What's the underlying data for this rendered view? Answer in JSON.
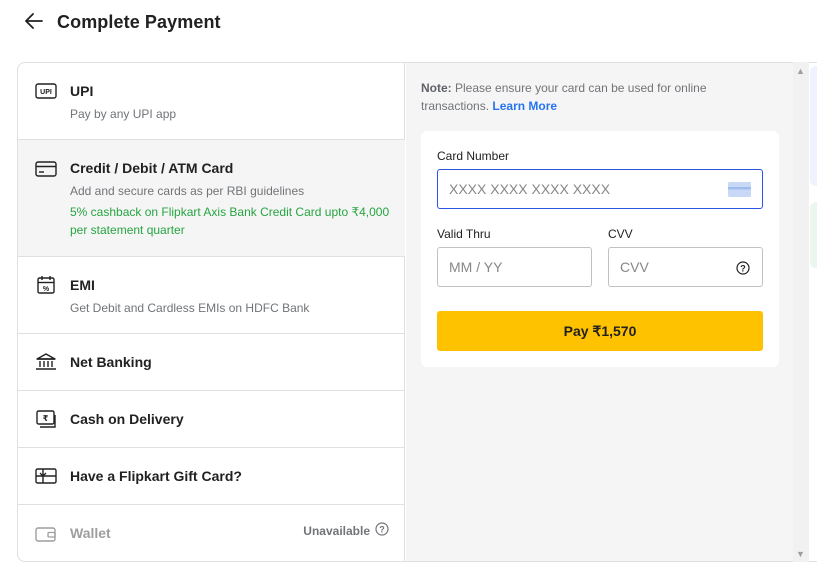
{
  "header": {
    "title": "Complete Payment",
    "back_icon": "arrow-left-icon"
  },
  "payment_options": [
    {
      "id": "upi",
      "icon": "upi-icon",
      "title": "UPI",
      "subtitle": "Pay by any UPI app"
    },
    {
      "id": "card",
      "icon": "card-icon",
      "title": "Credit / Debit / ATM Card",
      "subtitle": "Add and secure cards as per RBI guidelines",
      "offer": "5% cashback on Flipkart Axis Bank Credit Card upto ₹4,000 per statement quarter",
      "selected": true
    },
    {
      "id": "emi",
      "icon": "emi-calendar-icon",
      "title": "EMI",
      "subtitle": "Get Debit and Cardless EMIs on HDFC Bank"
    },
    {
      "id": "netbanking",
      "icon": "bank-icon",
      "title": "Net Banking"
    },
    {
      "id": "cod",
      "icon": "cash-icon",
      "title": "Cash on Delivery"
    },
    {
      "id": "giftcard",
      "icon": "gift-card-icon",
      "title": "Have a Flipkart Gift Card?"
    },
    {
      "id": "wallet",
      "icon": "wallet-icon",
      "title": "Wallet",
      "status": "Unavailable",
      "disabled": true
    }
  ],
  "card_form": {
    "note_label": "Note:",
    "note_text": "Please ensure your card can be used for online transactions.",
    "learn_more": "Learn More",
    "card_number_label": "Card Number",
    "card_number_placeholder": "XXXX XXXX XXXX XXXX",
    "valid_thru_label": "Valid Thru",
    "valid_thru_placeholder": "MM / YY",
    "cvv_label": "CVV",
    "cvv_placeholder": "CVV",
    "pay_button": "Pay ₹1,570"
  },
  "colors": {
    "accent": "#2874f0",
    "pay_button": "#ffc200",
    "offer_green": "#26a541",
    "focus_border": "#2a55e5"
  }
}
